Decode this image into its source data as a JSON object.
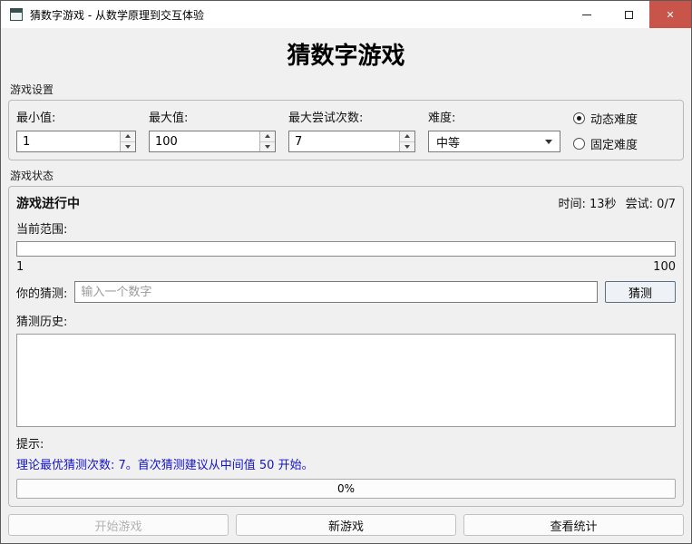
{
  "window": {
    "title": "猜数字游戏 - 从数学原理到交互体验",
    "close_glyph": "✕"
  },
  "header": {
    "title": "猜数字游戏"
  },
  "settings": {
    "group_label": "游戏设置",
    "min": {
      "label": "最小值:",
      "value": "1"
    },
    "max": {
      "label": "最大值:",
      "value": "100"
    },
    "attempts": {
      "label": "最大尝试次数:",
      "value": "7"
    },
    "difficulty": {
      "label": "难度:",
      "value": "中等"
    },
    "radios": {
      "dynamic": "动态难度",
      "fixed": "固定难度",
      "selected": "动态难度"
    }
  },
  "status": {
    "group_label": "游戏状态",
    "state": "游戏进行中",
    "time": "时间: 13秒",
    "attempts": "尝试: 0/7",
    "range_label": "当前范围:",
    "range_min": "1",
    "range_max": "100",
    "guess_label": "你的猜测:",
    "guess_placeholder": "输入一个数字",
    "guess_button": "猜测",
    "history_label": "猜测历史:",
    "hint_label": "提示:",
    "hint_text": "理论最优猜测次数: 7。首次猜测建议从中间值 50 开始。",
    "progress": "0%"
  },
  "footer": {
    "start": "开始游戏",
    "new": "新游戏",
    "stats": "查看统计"
  },
  "colors": {
    "background": "#f0f0f0",
    "titlebar": "#ffffff",
    "close_button": "#c9544a",
    "hint_text": "#1414cc"
  }
}
